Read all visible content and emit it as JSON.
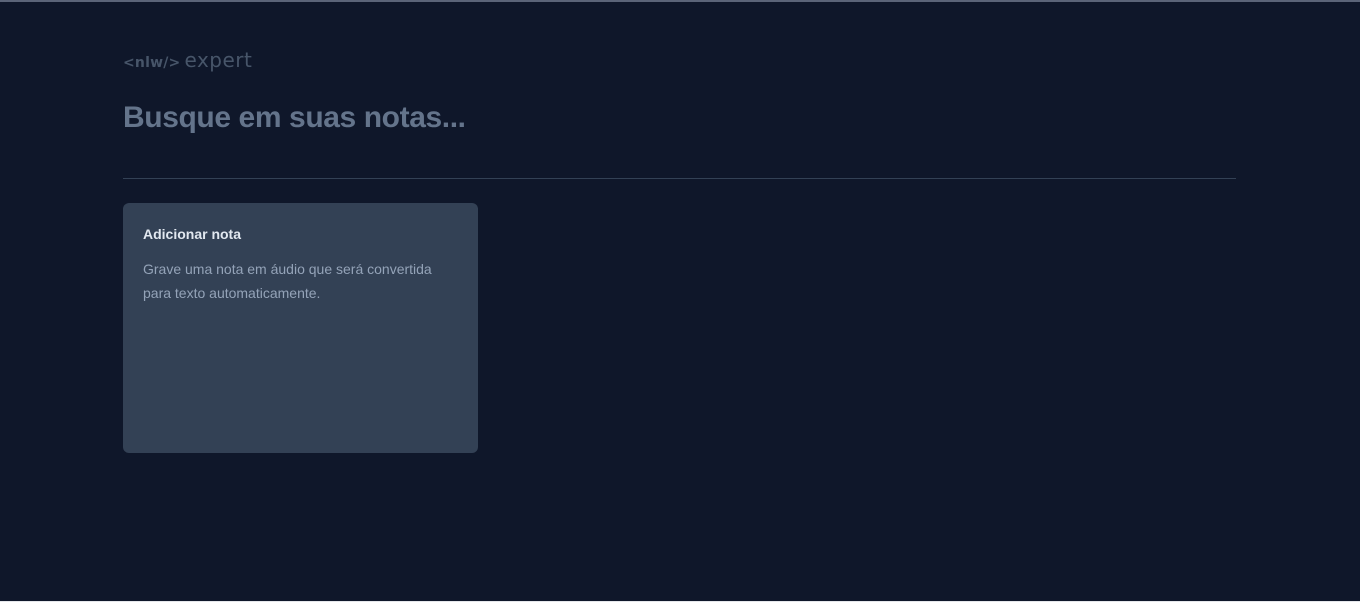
{
  "logo": {
    "nlw": "<nlw/>",
    "expert": "expert"
  },
  "search": {
    "placeholder": "Busque em suas notas...",
    "value": ""
  },
  "add_note_card": {
    "title": "Adicionar nota",
    "description": "Grave uma nota em áudio que será convertida para texto automaticamente."
  },
  "colors": {
    "background": "#0f172a",
    "card": "#334155",
    "divider": "#334155",
    "placeholder": "#64748b",
    "logo": "#475569",
    "card_title": "#e2e8f0",
    "card_text": "#94a3b8"
  }
}
